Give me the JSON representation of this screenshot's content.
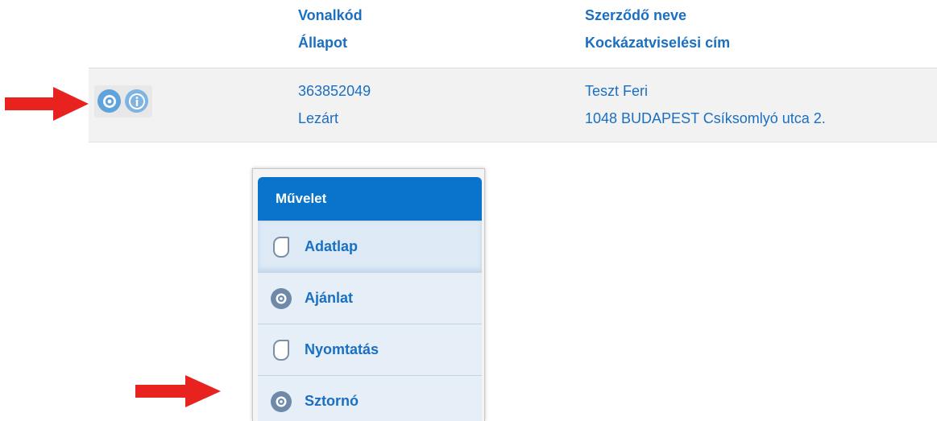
{
  "table": {
    "headers": {
      "col1_line1": "Vonalkód",
      "col1_line2": "Állapot",
      "col2_line1": "Szerződő neve",
      "col2_line2": "Kockázatviselési cím"
    },
    "row": {
      "barcode": "363852049",
      "status": "Lezárt",
      "contractor_name": "Teszt Feri",
      "risk_address": "1048 BUDAPEST Csíksomlyó utca 2."
    },
    "row_icons": [
      "gear-icon",
      "info-icon"
    ]
  },
  "context_menu": {
    "title": "Művelet",
    "items": [
      {
        "label": "Adatlap",
        "icon": "page-icon"
      },
      {
        "label": "Ajánlat",
        "icon": "gear-icon"
      },
      {
        "label": "Nyomtatás",
        "icon": "page-icon"
      },
      {
        "label": "Sztornó",
        "icon": "gear-icon"
      }
    ]
  },
  "annotations": {
    "arrow_color": "#e8231f"
  },
  "colors": {
    "link_blue": "#1a6fc2",
    "menu_header": "#0a74cc"
  }
}
